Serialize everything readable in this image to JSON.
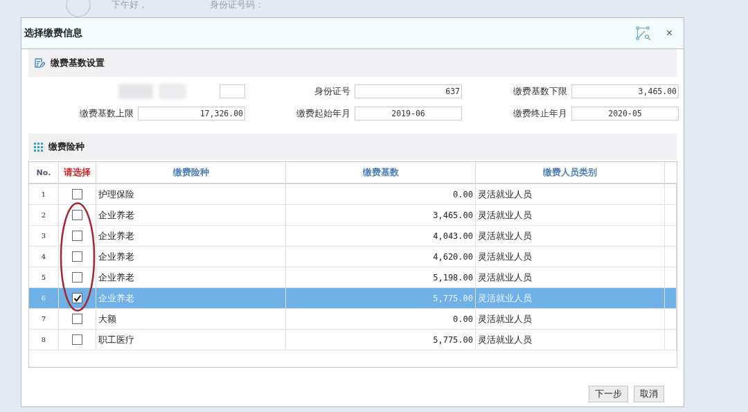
{
  "background": {
    "greeting": "下午好，",
    "id_label": "身份证号码："
  },
  "window": {
    "title": "选择缴费信息",
    "close": "×"
  },
  "base_section": {
    "title": "缴费基数设置",
    "fields": [
      {
        "kind": "redacted"
      },
      {
        "kind": "amount",
        "label": "身份证号",
        "value": "637"
      },
      {
        "kind": "amount",
        "label": "缴费基数下限",
        "value": "3,465.00"
      },
      {
        "kind": "amount",
        "label": "缴费基数上限",
        "value": "17,326.00"
      },
      {
        "kind": "date",
        "label": "缴费起始年月",
        "value": "2019-06"
      },
      {
        "kind": "date",
        "label": "缴费终止年月",
        "value": "2020-05"
      }
    ]
  },
  "insurance_section": {
    "title": "缴费险种",
    "table": {
      "columns": [
        "No.",
        "请选择",
        "缴费险种",
        "缴费基数",
        "缴费人员类别"
      ],
      "rows": [
        {
          "no": "1",
          "checked": false,
          "selected": false,
          "circled": false,
          "type": "护理保险",
          "base": "0.00",
          "category": "灵活就业人员"
        },
        {
          "no": "2",
          "checked": false,
          "selected": false,
          "circled": true,
          "type": "企业养老",
          "base": "3,465.00",
          "category": "灵活就业人员"
        },
        {
          "no": "3",
          "checked": false,
          "selected": false,
          "circled": true,
          "type": "企业养老",
          "base": "4,043.00",
          "category": "灵活就业人员"
        },
        {
          "no": "4",
          "checked": false,
          "selected": false,
          "circled": true,
          "type": "企业养老",
          "base": "4,620.00",
          "category": "灵活就业人员"
        },
        {
          "no": "5",
          "checked": false,
          "selected": false,
          "circled": true,
          "type": "企业养老",
          "base": "5,198.00",
          "category": "灵活就业人员"
        },
        {
          "no": "6",
          "checked": true,
          "selected": true,
          "circled": true,
          "type": "企业养老",
          "base": "5,775.00",
          "category": "灵活就业人员"
        },
        {
          "no": "7",
          "checked": false,
          "selected": false,
          "circled": false,
          "type": "大额",
          "base": "0.00",
          "category": "灵活就业人员"
        },
        {
          "no": "8",
          "checked": false,
          "selected": false,
          "circled": false,
          "type": "职工医疗",
          "base": "5,775.00",
          "category": "灵活就业人员"
        }
      ]
    }
  },
  "buttons": [
    "下一步",
    "取消"
  ]
}
